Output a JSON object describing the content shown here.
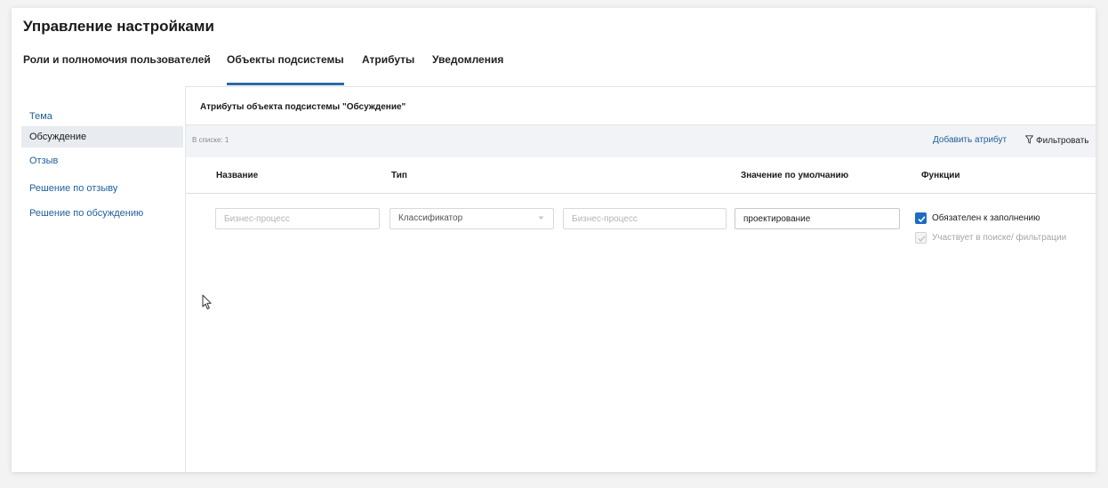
{
  "page": {
    "title": "Управление настройками"
  },
  "tabs": [
    {
      "label": "Роли и полномочия пользователей"
    },
    {
      "label": "Объекты подсистемы",
      "active": true
    },
    {
      "label": "Атрибуты"
    },
    {
      "label": "Уведомления"
    }
  ],
  "sidebar": {
    "items": [
      {
        "label": "Тема"
      },
      {
        "label": "Обсуждение",
        "active": true
      },
      {
        "label": "Отзыв"
      },
      {
        "label": "Решение по отзыву"
      },
      {
        "label": "Решение по обсуждению"
      }
    ]
  },
  "main": {
    "section_title": "Атрибуты объекта подсистемы \"Обсуждение\"",
    "count_text": "В списке: 1",
    "add_attribute_label": "Добавить атрибут",
    "filter_label": "Фильтровать",
    "filter_icon": "funnel-icon",
    "columns": {
      "name": "Название",
      "type": "Тип",
      "default": "Значение по умолчанию",
      "functions": "Функции"
    },
    "row": {
      "name_placeholder": "Бизнес-процесс",
      "type_value": "Классификатор",
      "type_icon": "chevron-down-icon",
      "classifier_placeholder": "Бизнес-процесс",
      "default_value": "проектирование",
      "required_label": "Обязателен к заполнению",
      "required_checked": true,
      "search_label": "Участвует в поиске/ фильтрации",
      "search_checked": true,
      "search_disabled": true
    }
  },
  "colors": {
    "accent": "#2d6aa3",
    "link": "#1f5f9a",
    "checkbox": "#1e6bc4",
    "active_item_bg": "#e8ebef"
  }
}
